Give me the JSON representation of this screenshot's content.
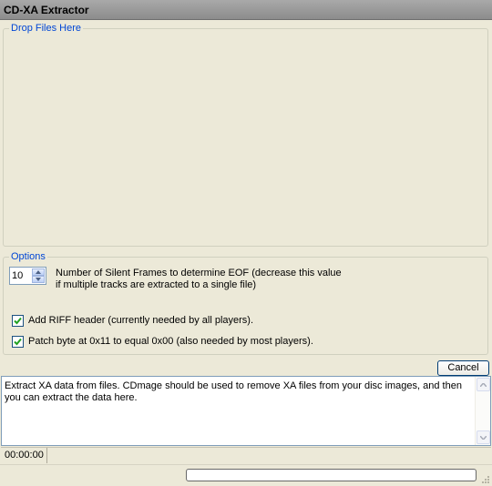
{
  "window": {
    "title": "CD-XA Extractor"
  },
  "drop_group": {
    "legend": "Drop Files Here"
  },
  "options": {
    "legend": "Options",
    "silent_frames_value": "10",
    "silent_frames_label": "Number of Silent Frames to determine EOF (decrease this value if multiple tracks are extracted to a single file)",
    "add_riff_label": "Add RIFF header (currently needed by all players).",
    "add_riff_checked": true,
    "patch_byte_label": "Patch byte at 0x11 to equal 0x00 (also needed by most players).",
    "patch_byte_checked": true
  },
  "cancel_label": "Cancel",
  "log_text": "Extract XA data from files.  CDmage should be used to remove XA files from your disc images, and then you can extract the data here.",
  "status": {
    "time": "00:00:00"
  },
  "progress": {
    "value": 0
  },
  "colors": {
    "legend": "#0046d5",
    "check": "#21a121",
    "face": "#ece9d8"
  },
  "icons": [
    "spin-up-icon",
    "spin-down-icon",
    "checkmark-icon",
    "scroll-up-icon",
    "scroll-down-icon",
    "resize-grip-icon"
  ]
}
